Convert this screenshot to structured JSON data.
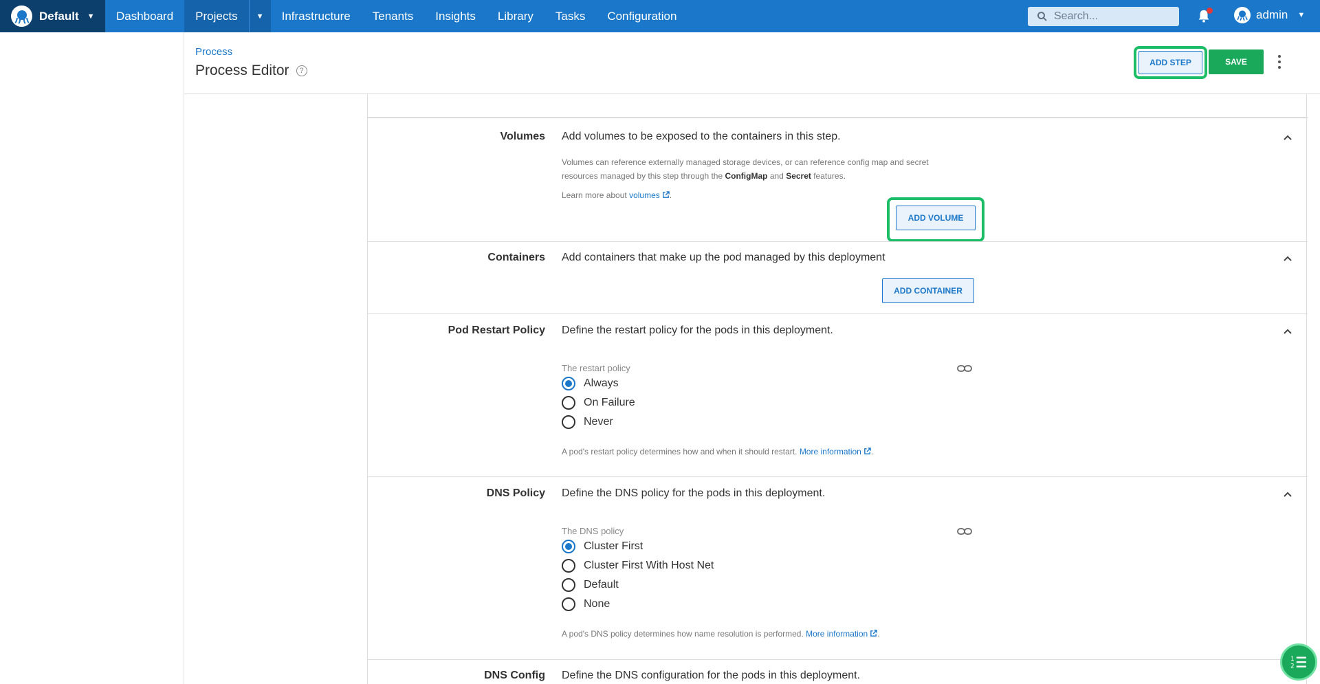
{
  "topbar": {
    "space_name": "Default",
    "nav": [
      "Dashboard",
      "Projects",
      "Infrastructure",
      "Tenants",
      "Insights",
      "Library",
      "Tasks",
      "Configuration"
    ],
    "search_placeholder": "Search...",
    "user": "admin"
  },
  "header": {
    "breadcrumb": "Process",
    "title": "Process Editor",
    "add_step": "ADD STEP",
    "save": "SAVE"
  },
  "volumes": {
    "label": "Volumes",
    "desc": "Add volumes to be exposed to the containers in this step.",
    "help1": "Volumes can reference externally managed storage devices, or can reference config map and secret",
    "help2_a": "resources managed by this step through the ",
    "help2_b": "ConfigMap",
    "help2_c": " and ",
    "help2_d": "Secret",
    "help2_e": " features.",
    "learn_prefix": "Learn more about ",
    "learn_link": "volumes",
    "learn_suffix": ".",
    "button": "ADD VOLUME"
  },
  "containers": {
    "label": "Containers",
    "desc": "Add containers that make up the pod managed by this deployment",
    "button": "ADD CONTAINER"
  },
  "restart": {
    "label": "Pod Restart Policy",
    "desc": "Define the restart policy for the pods in this deployment.",
    "field_label": "The restart policy",
    "options": [
      "Always",
      "On Failure",
      "Never"
    ],
    "selected": "Always",
    "help_prefix": "A pod's restart policy determines how and when it should restart. ",
    "help_link": "More information",
    "help_suffix": "."
  },
  "dns": {
    "label": "DNS Policy",
    "desc": "Define the DNS policy for the pods in this deployment.",
    "field_label": "The DNS policy",
    "options": [
      "Cluster First",
      "Cluster First With Host Net",
      "Default",
      "None"
    ],
    "selected": "Cluster First",
    "help_prefix": "A pod's DNS policy determines how name resolution is performed. ",
    "help_link": "More information",
    "help_suffix": "."
  },
  "dns_config": {
    "label": "DNS Config",
    "desc": "Define the DNS configuration for the pods in this deployment."
  },
  "colors": {
    "brand": "#1a77ca",
    "save": "#1aa85b",
    "highlight": "#1bbd66"
  }
}
